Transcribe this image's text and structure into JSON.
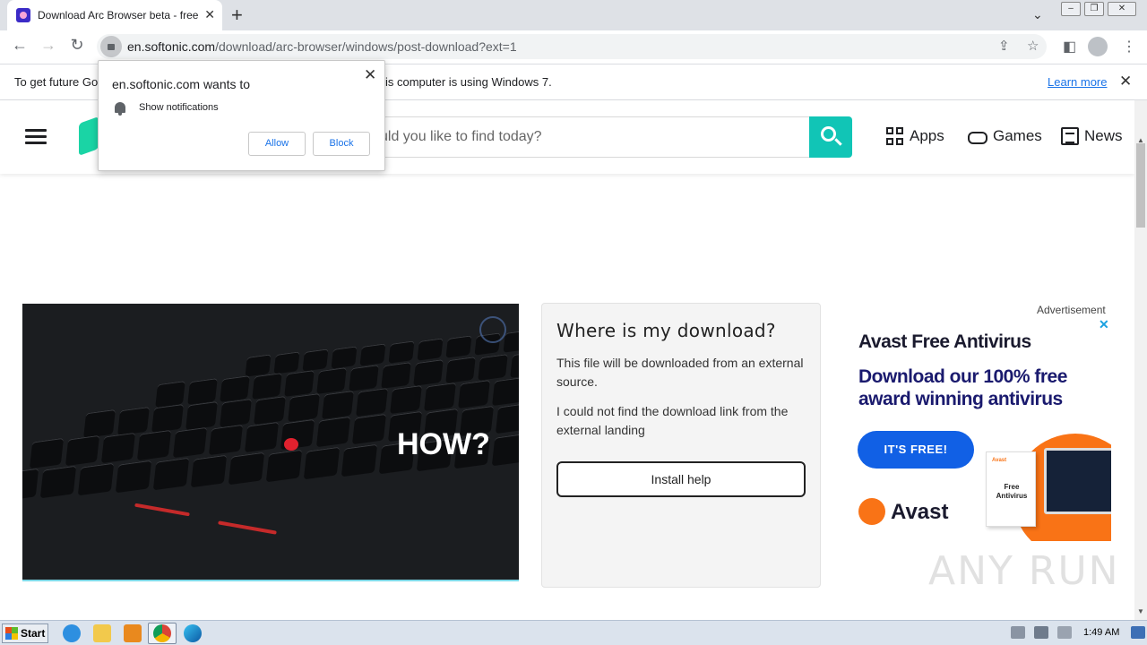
{
  "browser": {
    "tab_title": "Download Arc Browser beta - free - ",
    "url_host": "en.softonic.com",
    "url_path": "/download/arc-browser/windows/post-download?ext=1"
  },
  "infobar": {
    "text_start": "To get future Go",
    "text_end": "is computer is using Windows 7.",
    "learn_more": "Learn more"
  },
  "notification_prompt": {
    "title": "en.softonic.com wants to",
    "permission": "Show notifications",
    "allow_label": "Allow",
    "block_label": "Block"
  },
  "site": {
    "search_placeholder": "uld you like to find today?",
    "nav": [
      {
        "label": "Apps",
        "icon": "apps-grid-icon"
      },
      {
        "label": "Games",
        "icon": "gamepad-icon"
      },
      {
        "label": "News",
        "icon": "news-icon"
      }
    ],
    "accent_color": "#11c5b6"
  },
  "hero_image": {
    "overlay_text": "HOW?"
  },
  "download_card": {
    "title": "Where is my download?",
    "para1": "This file will be downloaded from an external source.",
    "para2": "I could not find the download link from the external landing",
    "button": "Install help"
  },
  "advertisement": {
    "label": "Advertisement",
    "headline": "Avast Free Antivirus",
    "subheadline": "Download our 100% free award winning antivirus",
    "cta": "IT'S FREE!",
    "box_text": "Free Antivirus",
    "box_brand": "Avast",
    "brand": "Avast",
    "brand_color": "#f97316",
    "cta_color": "#1160e5"
  },
  "watermark": "ANY RUN",
  "taskbar": {
    "start_label": "Start",
    "clock": "1:49 AM"
  }
}
